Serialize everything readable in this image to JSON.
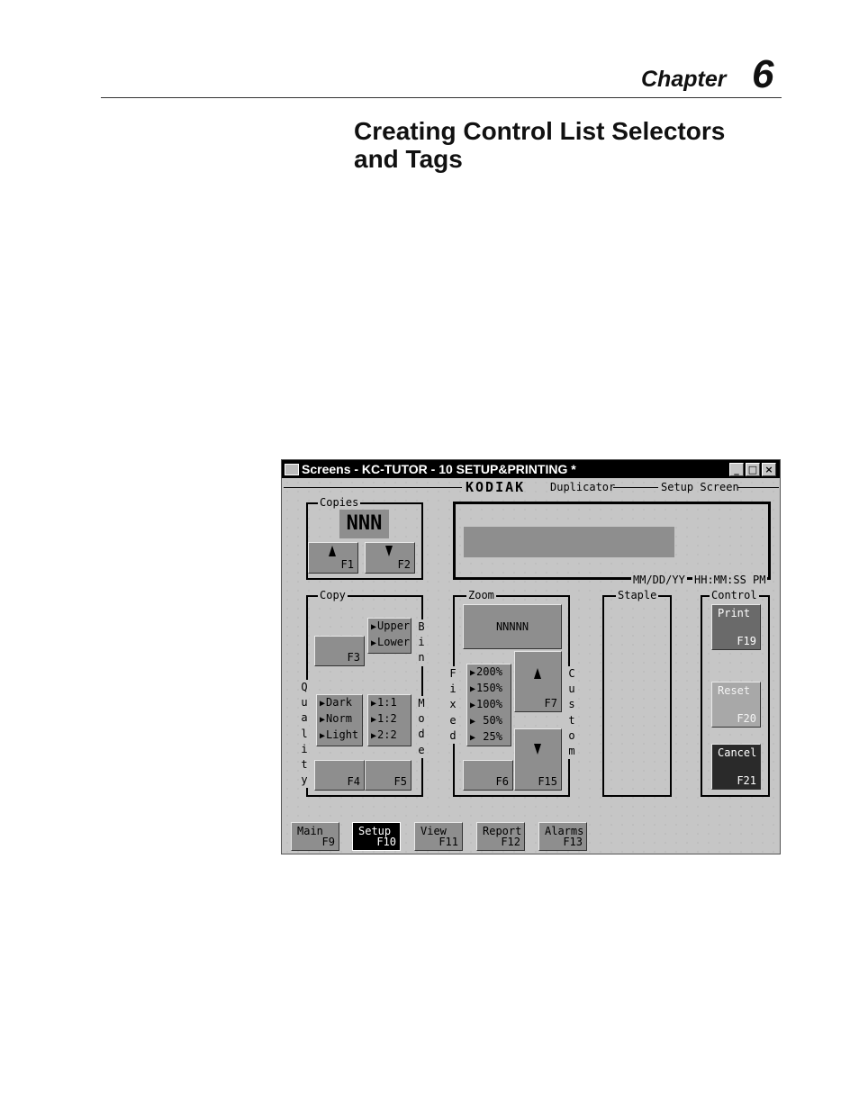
{
  "header": {
    "chapter_label": "Chapter",
    "chapter_number": "6"
  },
  "title": {
    "line1": "Creating Control List Selectors",
    "line2": "and Tags"
  },
  "window": {
    "title": "Screens - KC-TUTOR -  10 SETUP&PRINTING *",
    "controls": {
      "minimize": "_",
      "maximize": "□",
      "close": "×"
    },
    "banner": {
      "brand": "KODIAK",
      "product": "Duplicator",
      "screen": "Setup Screen"
    },
    "copies": {
      "label": "Copies",
      "display": "NNN",
      "up_key": "F1",
      "down_key": "F2"
    },
    "message": {
      "date": "MM/DD/YY",
      "time": "HH:MM:SS PM"
    },
    "copy": {
      "label": "Copy",
      "f3_key": "F3",
      "bin_options": [
        "Upper",
        "Lower"
      ],
      "bin_label": "Bin",
      "quality_label": "Quality",
      "quality_options": [
        "Dark",
        "Norm",
        "Light"
      ],
      "mode_label": "Mode",
      "mode_options": [
        "1:1",
        "1:2",
        "2:2"
      ],
      "f4_key": "F4",
      "f5_key": "F5"
    },
    "zoom": {
      "label": "Zoom",
      "display": "NNNNN",
      "fixed_label": "Fixed",
      "custom_label": "Custom",
      "fixed_options": [
        "200%",
        "150%",
        "100%",
        " 50%",
        " 25%"
      ],
      "up_key": "F7",
      "down_key": "F15",
      "fixed_key": "F6"
    },
    "staple": {
      "label": "Staple"
    },
    "control": {
      "label": "Control",
      "print": {
        "label": "Print",
        "key": "F19"
      },
      "reset": {
        "label": "Reset",
        "key": "F20"
      },
      "cancel": {
        "label": "Cancel",
        "key": "F21"
      }
    },
    "nav": [
      {
        "label": "Main",
        "key": "F9"
      },
      {
        "label": "Setup",
        "key": "F10"
      },
      {
        "label": "View",
        "key": "F11"
      },
      {
        "label": "Report",
        "key": "F12"
      },
      {
        "label": "Alarms",
        "key": "F13"
      }
    ]
  }
}
